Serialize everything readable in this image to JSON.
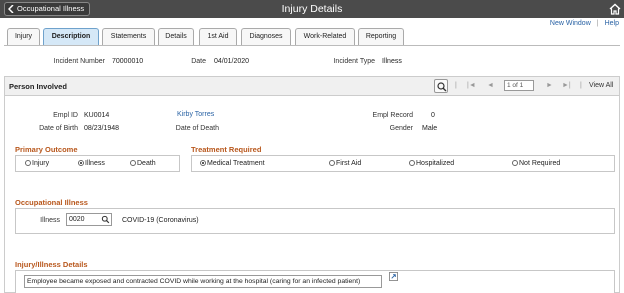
{
  "header": {
    "back_label": "Occupational Illness",
    "title": "Injury Details",
    "home_icon": "home-icon"
  },
  "top_links": {
    "new_window": "New Window",
    "sep": "|",
    "help": "Help"
  },
  "tabs": [
    "Injury",
    "Description",
    "Statements",
    "Details",
    "1st Aid",
    "Diagnoses",
    "Work-Related",
    "Reporting"
  ],
  "incident": {
    "number_label": "Incident Number",
    "number": "70000010",
    "date_label": "Date",
    "date": "04/01/2020",
    "type_label": "Incident Type",
    "type": "Illness"
  },
  "person_panel": {
    "title": "Person Involved",
    "pager": {
      "first": "|◄",
      "prev": "◄",
      "page": "1 of 1",
      "next": "►",
      "last": "►|",
      "sep": "|",
      "view_all": "View All"
    }
  },
  "person": {
    "empl_id_label": "Empl ID",
    "empl_id": "KU0014",
    "name": "Kirby Torres",
    "empl_record_label": "Empl Record",
    "empl_record": "0",
    "dob_label": "Date of Birth",
    "dob": "08/23/1948",
    "dod_label": "Date of Death",
    "dod": "",
    "gender_label": "Gender",
    "gender": "Male"
  },
  "primary_outcome": {
    "title": "Primary Outcome",
    "options": [
      "Injury",
      "Illness",
      "Death"
    ],
    "selected": "Illness"
  },
  "treatment": {
    "title": "Treatment Required",
    "options": [
      "Medical Treatment",
      "First Aid",
      "Hospitalized",
      "Not Required"
    ],
    "selected": "Medical Treatment"
  },
  "occupational": {
    "title": "Occupational Illness",
    "illness_label": "Illness",
    "illness_code": "0020",
    "illness_desc": "COVID-19 (Coronavirus)"
  },
  "details": {
    "title": "Injury/Illness Details",
    "text": "Employee became exposed and contracted COVID while working at the hospital (caring for an infected patient)"
  }
}
